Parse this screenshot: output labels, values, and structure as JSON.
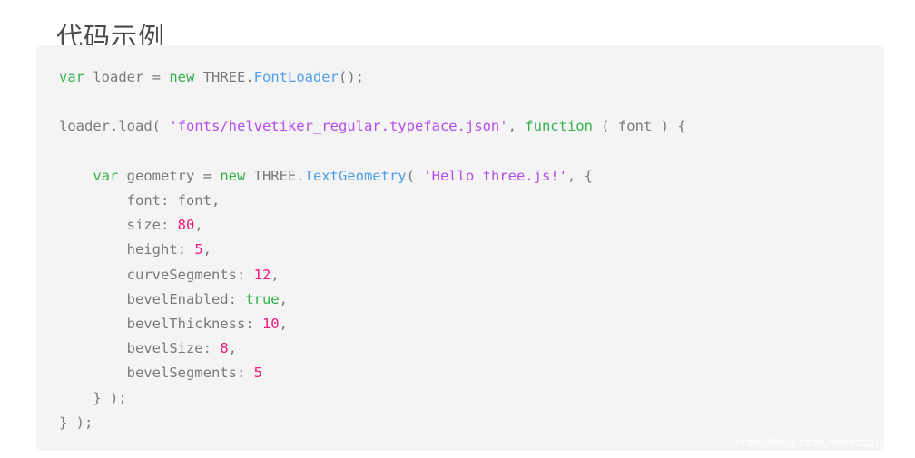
{
  "page": {
    "title": "代码示例",
    "background_color": "#ffffff"
  },
  "code_block": {
    "background_color": "#f4f4f4",
    "language": "javascript",
    "default_text_color": "#7a7a7a",
    "token_colors": {
      "keyword": "#36b14e",
      "class": "#4d9fe8",
      "string": "#b54bec",
      "number": "#f0197f",
      "plain": "#7a7a7a",
      "punctuation": "#9a9a9a"
    },
    "lines": [
      {
        "index": 1,
        "text": "var loader = new THREE.FontLoader();",
        "tokens": [
          {
            "t": "var",
            "c": "keyword"
          },
          {
            "t": " loader = ",
            "c": "plain"
          },
          {
            "t": "new",
            "c": "keyword"
          },
          {
            "t": " THREE.",
            "c": "plain"
          },
          {
            "t": "FontLoader",
            "c": "class"
          },
          {
            "t": "();",
            "c": "plain"
          }
        ]
      },
      {
        "index": 2,
        "text": "",
        "tokens": []
      },
      {
        "index": 3,
        "text": "loader.load( 'fonts/helvetiker_regular.typeface.json', function ( font ) {",
        "tokens": [
          {
            "t": "loader.load( ",
            "c": "plain"
          },
          {
            "t": "'fonts/helvetiker_regular.typeface.json'",
            "c": "string"
          },
          {
            "t": ", ",
            "c": "plain"
          },
          {
            "t": "function",
            "c": "keyword"
          },
          {
            "t": " ( font ) {",
            "c": "plain"
          }
        ]
      },
      {
        "index": 4,
        "text": "",
        "tokens": []
      },
      {
        "index": 5,
        "text": "    var geometry = new THREE.TextGeometry( 'Hello three.js!', {",
        "tokens": [
          {
            "t": "    ",
            "c": "plain"
          },
          {
            "t": "var",
            "c": "keyword"
          },
          {
            "t": " geometry = ",
            "c": "plain"
          },
          {
            "t": "new",
            "c": "keyword"
          },
          {
            "t": " THREE.",
            "c": "plain"
          },
          {
            "t": "TextGeometry",
            "c": "class"
          },
          {
            "t": "( ",
            "c": "plain"
          },
          {
            "t": "'Hello three.js!'",
            "c": "string"
          },
          {
            "t": ", {",
            "c": "plain"
          }
        ]
      },
      {
        "index": 6,
        "text": "        font: font,",
        "tokens": [
          {
            "t": "        font: font,",
            "c": "plain"
          }
        ]
      },
      {
        "index": 7,
        "text": "        size: 80,",
        "tokens": [
          {
            "t": "        size: ",
            "c": "plain"
          },
          {
            "t": "80",
            "c": "number"
          },
          {
            "t": ",",
            "c": "plain"
          }
        ]
      },
      {
        "index": 8,
        "text": "        height: 5,",
        "tokens": [
          {
            "t": "        height: ",
            "c": "plain"
          },
          {
            "t": "5",
            "c": "number"
          },
          {
            "t": ",",
            "c": "plain"
          }
        ]
      },
      {
        "index": 9,
        "text": "        curveSegments: 12,",
        "tokens": [
          {
            "t": "        curveSegments: ",
            "c": "plain"
          },
          {
            "t": "12",
            "c": "number"
          },
          {
            "t": ",",
            "c": "plain"
          }
        ]
      },
      {
        "index": 10,
        "text": "        bevelEnabled: true,",
        "tokens": [
          {
            "t": "        bevelEnabled: ",
            "c": "plain"
          },
          {
            "t": "true",
            "c": "keyword"
          },
          {
            "t": ",",
            "c": "plain"
          }
        ]
      },
      {
        "index": 11,
        "text": "        bevelThickness: 10,",
        "tokens": [
          {
            "t": "        bevelThickness: ",
            "c": "plain"
          },
          {
            "t": "10",
            "c": "number"
          },
          {
            "t": ",",
            "c": "plain"
          }
        ]
      },
      {
        "index": 12,
        "text": "        bevelSize: 8,",
        "tokens": [
          {
            "t": "        bevelSize: ",
            "c": "plain"
          },
          {
            "t": "8",
            "c": "number"
          },
          {
            "t": ",",
            "c": "plain"
          }
        ]
      },
      {
        "index": 13,
        "text": "        bevelSegments: 5",
        "tokens": [
          {
            "t": "        bevelSegments: ",
            "c": "plain"
          },
          {
            "t": "5",
            "c": "number"
          }
        ]
      },
      {
        "index": 14,
        "text": "    } );",
        "tokens": [
          {
            "t": "    } );",
            "c": "plain"
          }
        ]
      },
      {
        "index": 15,
        "text": "} );",
        "tokens": [
          {
            "t": "} );",
            "c": "plain"
          }
        ]
      }
    ]
  },
  "watermark": {
    "text": "https://blog.csdn.net/dotaplayit"
  }
}
